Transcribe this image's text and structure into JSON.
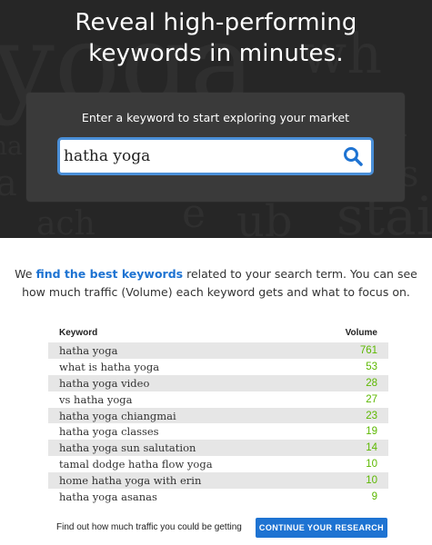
{
  "hero": {
    "title_line1": "Reveal high-performing",
    "title_line2": "keywords in minutes.",
    "search_prompt": "Enter a keyword to start exploring your market",
    "search_value": "hatha yoga",
    "search_icon": "search-icon"
  },
  "intro": {
    "prefix": "We ",
    "link": "find the best keywords",
    "suffix": " related to your search term. You can see how much traffic (Volume) each keyword gets and what to focus on."
  },
  "table": {
    "headers": {
      "keyword": "Keyword",
      "volume": "Volume"
    },
    "rows": [
      {
        "keyword": "hatha yoga",
        "volume": "761"
      },
      {
        "keyword": "what is hatha yoga",
        "volume": "53"
      },
      {
        "keyword": "hatha yoga video",
        "volume": "28"
      },
      {
        "keyword": "vs hatha yoga",
        "volume": "27"
      },
      {
        "keyword": "hatha yoga chiangmai",
        "volume": "23"
      },
      {
        "keyword": "hatha yoga classes",
        "volume": "19"
      },
      {
        "keyword": "hatha yoga sun salutation",
        "volume": "14"
      },
      {
        "keyword": "tamal dodge hatha flow yoga",
        "volume": "10"
      },
      {
        "keyword": "home hatha yoga with erin",
        "volume": "10"
      },
      {
        "keyword": "hatha yoga asanas",
        "volume": "9"
      }
    ]
  },
  "footer": {
    "text": "Find out how much traffic you could be getting",
    "cta": "CONTINUE YOUR RESEARCH"
  },
  "colors": {
    "accent": "#1e73d2",
    "volume_green": "#5cb800",
    "search_border": "#4a8fd8"
  }
}
